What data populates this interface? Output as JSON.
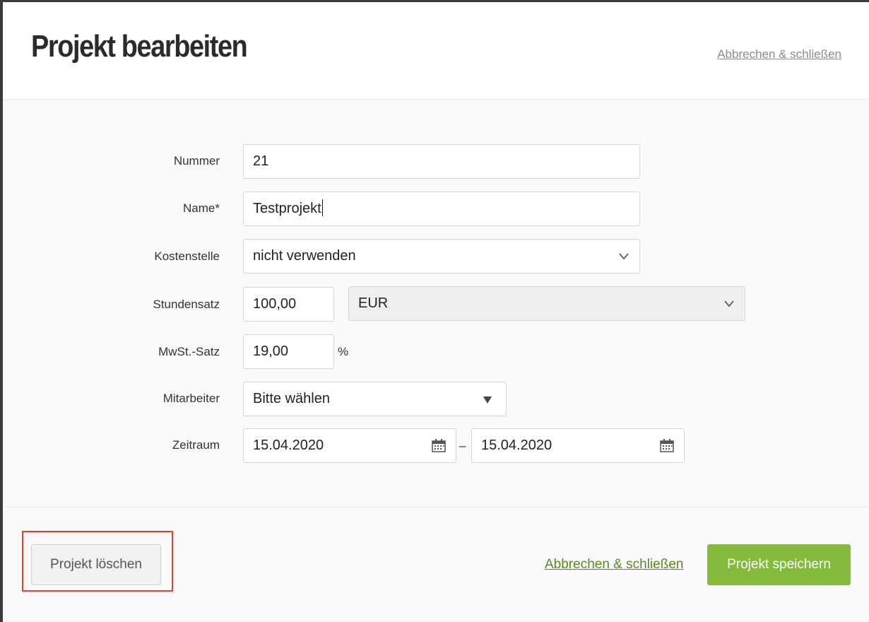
{
  "header": {
    "title": "Projekt bearbeiten",
    "cancel_link": "Abbrechen & schließen"
  },
  "form": {
    "nummer": {
      "label": "Nummer",
      "value": "21"
    },
    "name": {
      "label": "Name*",
      "value": "Testprojekt"
    },
    "kostenstelle": {
      "label": "Kostenstelle",
      "value": "nicht verwenden"
    },
    "stundensatz": {
      "label": "Stundensatz",
      "value": "100,00",
      "currency": "EUR"
    },
    "mwst": {
      "label": "MwSt.-Satz",
      "value": "19,00",
      "unit": "%"
    },
    "mitarbeiter": {
      "label": "Mitarbeiter",
      "value": "Bitte wählen"
    },
    "zeitraum": {
      "label": "Zeitraum",
      "from": "15.04.2020",
      "separator": "–",
      "to": "15.04.2020"
    }
  },
  "footer": {
    "delete_label": "Projekt löschen",
    "cancel_link": "Abbrechen & schließen",
    "save_label": "Projekt speichern"
  },
  "colors": {
    "accent_green": "#84bb3c",
    "link_green": "#5c8a1e",
    "highlight_red": "#e2432c"
  },
  "icons": {
    "dropdown": "chevron-down-icon",
    "select_arrow": "triangle-down-icon",
    "date": "calendar-icon"
  }
}
